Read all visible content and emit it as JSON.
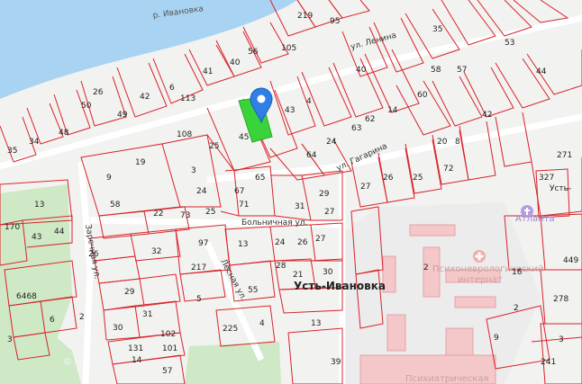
{
  "map": {
    "river_name": "р. Ивановка",
    "streets": {
      "lenina": "ул. Ленина",
      "gagarina": "ул. Гагарина",
      "bolnichnaya": "Больничная ул.",
      "zarechnaya": "Заречная ул.",
      "lesnaya": "Лесная ул."
    },
    "settlement_name": "Усть-Ивановка",
    "settlement_name_truncated": "Усть-",
    "poi": {
      "psycho_line1": "Психоневрологический",
      "psycho_line2": "интернат",
      "psychiatric": "Психиатрическая",
      "atlanta": "Атланта"
    },
    "marker_icon": "location-pin-icon",
    "watermark": "©",
    "parcel_numbers": [
      {
        "id": "p1",
        "text": "219"
      },
      {
        "id": "p2",
        "text": "95"
      },
      {
        "id": "p3",
        "text": "105"
      },
      {
        "id": "p4",
        "text": "56"
      },
      {
        "id": "p5",
        "text": "40"
      },
      {
        "id": "p6",
        "text": "41"
      },
      {
        "id": "p7",
        "text": "35"
      },
      {
        "id": "p8",
        "text": "53"
      },
      {
        "id": "p9",
        "text": "44"
      },
      {
        "id": "p10",
        "text": "42"
      },
      {
        "id": "p11",
        "text": "6"
      },
      {
        "id": "p12",
        "text": "113"
      },
      {
        "id": "p13",
        "text": "26"
      },
      {
        "id": "p14",
        "text": "49"
      },
      {
        "id": "p15",
        "text": "50"
      },
      {
        "id": "p16",
        "text": "48"
      },
      {
        "id": "p17",
        "text": "34"
      },
      {
        "id": "p18",
        "text": "35"
      },
      {
        "id": "p19",
        "text": "19"
      },
      {
        "id": "p20",
        "text": "9"
      },
      {
        "id": "p21",
        "text": "108"
      },
      {
        "id": "p22",
        "text": "25"
      },
      {
        "id": "p23",
        "text": "45"
      },
      {
        "id": "p24",
        "text": "4"
      },
      {
        "id": "p25",
        "text": "43"
      },
      {
        "id": "p26",
        "text": "40"
      },
      {
        "id": "p27",
        "text": "62"
      },
      {
        "id": "p28",
        "text": "14"
      },
      {
        "id": "p29",
        "text": "60"
      },
      {
        "id": "p30",
        "text": "58"
      },
      {
        "id": "p31",
        "text": "57"
      },
      {
        "id": "p32",
        "text": "42"
      },
      {
        "id": "p33",
        "text": "20"
      },
      {
        "id": "p34",
        "text": "8"
      },
      {
        "id": "p35",
        "text": "72"
      },
      {
        "id": "p36",
        "text": "24"
      },
      {
        "id": "p37",
        "text": "64"
      },
      {
        "id": "p38",
        "text": "63"
      },
      {
        "id": "p39",
        "text": "26"
      },
      {
        "id": "p40",
        "text": "25"
      },
      {
        "id": "p41",
        "text": "27"
      },
      {
        "id": "p42",
        "text": "271"
      },
      {
        "id": "p43",
        "text": "327"
      },
      {
        "id": "p44",
        "text": "13"
      },
      {
        "id": "p45",
        "text": "58"
      },
      {
        "id": "p46",
        "text": "22"
      },
      {
        "id": "p47",
        "text": "3"
      },
      {
        "id": "p48",
        "text": "24"
      },
      {
        "id": "p49",
        "text": "65"
      },
      {
        "id": "p50",
        "text": "67"
      },
      {
        "id": "p51",
        "text": "71"
      },
      {
        "id": "p52",
        "text": "31"
      },
      {
        "id": "p53",
        "text": "29"
      },
      {
        "id": "p54",
        "text": "27"
      },
      {
        "id": "p55",
        "text": "170"
      },
      {
        "id": "p56",
        "text": "43"
      },
      {
        "id": "p57",
        "text": "44"
      },
      {
        "id": "p58",
        "text": "73"
      },
      {
        "id": "p59",
        "text": "25"
      },
      {
        "id": "p60",
        "text": "97"
      },
      {
        "id": "p61",
        "text": "13"
      },
      {
        "id": "p62",
        "text": "24"
      },
      {
        "id": "p63",
        "text": "26"
      },
      {
        "id": "p64",
        "text": "27"
      },
      {
        "id": "p65",
        "text": "6468"
      },
      {
        "id": "p66",
        "text": "26"
      },
      {
        "id": "p67",
        "text": "32"
      },
      {
        "id": "p68",
        "text": "217"
      },
      {
        "id": "p69",
        "text": "28"
      },
      {
        "id": "p70",
        "text": "21"
      },
      {
        "id": "p71",
        "text": "30"
      },
      {
        "id": "p72",
        "text": "29"
      },
      {
        "id": "p73",
        "text": "55"
      },
      {
        "id": "p74",
        "text": "5"
      },
      {
        "id": "p75",
        "text": "6"
      },
      {
        "id": "p76",
        "text": "2"
      },
      {
        "id": "p77",
        "text": "30"
      },
      {
        "id": "p78",
        "text": "31"
      },
      {
        "id": "p79",
        "text": "225"
      },
      {
        "id": "p80",
        "text": "4"
      },
      {
        "id": "p81",
        "text": "13"
      },
      {
        "id": "p82",
        "text": "102"
      },
      {
        "id": "p83",
        "text": "101"
      },
      {
        "id": "p84",
        "text": "131"
      },
      {
        "id": "p85",
        "text": "14"
      },
      {
        "id": "p86",
        "text": "57"
      },
      {
        "id": "p87",
        "text": "39"
      },
      {
        "id": "p88",
        "text": "9"
      },
      {
        "id": "p89",
        "text": "278"
      },
      {
        "id": "p90",
        "text": "449"
      },
      {
        "id": "p91",
        "text": "3"
      },
      {
        "id": "p92",
        "text": "241"
      },
      {
        "id": "p93",
        "text": "2"
      },
      {
        "id": "p94",
        "text": "16"
      },
      {
        "id": "p95",
        "text": "3"
      },
      {
        "id": "p96",
        "text": "2"
      }
    ]
  }
}
